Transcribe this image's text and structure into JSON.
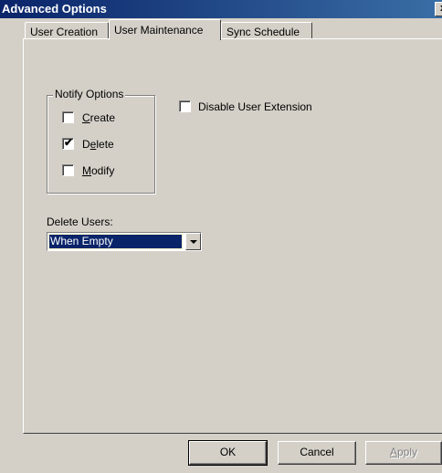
{
  "window": {
    "title": "Advanced Options"
  },
  "tabs": [
    {
      "label": "User Creation",
      "active": false
    },
    {
      "label": "User Maintenance",
      "active": true
    },
    {
      "label": "Sync Schedule",
      "active": false
    }
  ],
  "notify_options": {
    "label": "Notify Options",
    "items": [
      {
        "pre": "",
        "mnemonic": "C",
        "post": "reate",
        "checked": false
      },
      {
        "pre": "D",
        "mnemonic": "e",
        "post": "lete",
        "checked": true
      },
      {
        "pre": "",
        "mnemonic": "M",
        "post": "odify",
        "checked": false
      }
    ]
  },
  "disable_extension": {
    "label": "Disable User Extension",
    "checked": false
  },
  "delete_users": {
    "label": "Delete Users:",
    "value": "When Empty"
  },
  "buttons": {
    "ok": "OK",
    "cancel": "Cancel",
    "apply_mnemonic": "A",
    "apply_rest": "pply"
  },
  "glyphs": {
    "check": "✔",
    "close": "x"
  }
}
